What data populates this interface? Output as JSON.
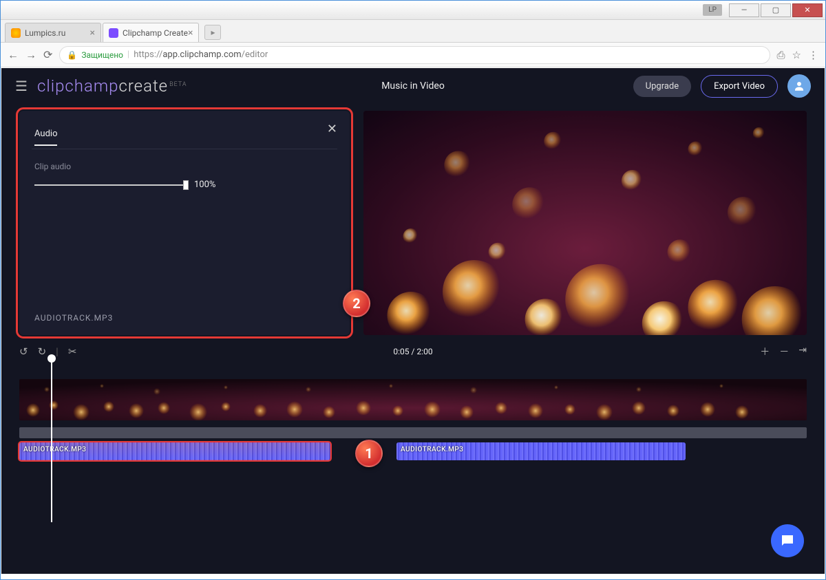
{
  "titlebar": {
    "badge": "LP"
  },
  "tabs": [
    {
      "label": "Lumpics.ru",
      "active": false
    },
    {
      "label": "Clipchamp Create",
      "active": true
    }
  ],
  "url": {
    "secure_label": "Защищено",
    "scheme": "https://",
    "host": "app.clipchamp.com",
    "path": "/editor"
  },
  "logo": {
    "brand": "clipchamp",
    "sub": "create",
    "tag": "BETA"
  },
  "project_title": "Music in Video",
  "buttons": {
    "upgrade": "Upgrade",
    "export": "Export Video"
  },
  "panel": {
    "tab": "Audio",
    "section_label": "Clip audio",
    "volume": "100%",
    "filename": "AUDIOTRACK.MP3"
  },
  "annotations": {
    "one": "1",
    "two": "2"
  },
  "timeline": {
    "time": "0:05 / 2:00",
    "audio_clips": [
      {
        "label": "AUDIOTRACK.MP3"
      },
      {
        "label": "AUDIOTRACK.MP3"
      }
    ]
  }
}
